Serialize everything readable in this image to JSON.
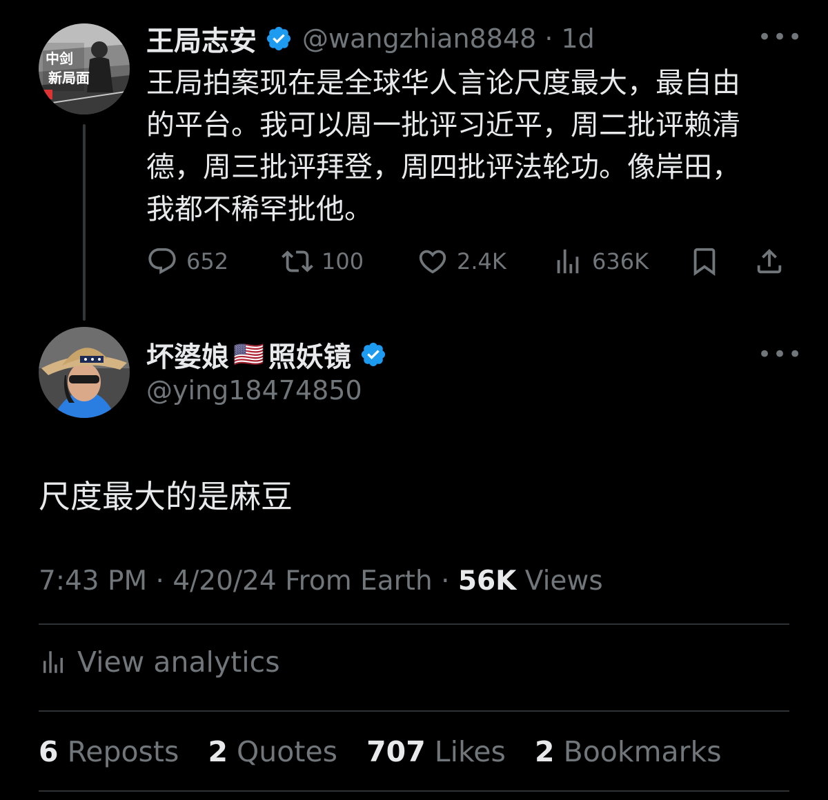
{
  "parent_tweet": {
    "author_name": "王局志安",
    "handle_time": "@wangzhian8848 · 1d",
    "text": "王局拍案现在是全球华人言论尺度最大，最自由的平台。我可以周一批评习近平，周二批评赖清德，周三批评拜登，周四批评法轮功。像岸田，我都不稀罕批他。",
    "avatar_text": "中剑新局面",
    "actions": {
      "replies": "652",
      "reposts": "100",
      "likes": "2.4K",
      "views": "636K"
    },
    "more_icon": "more-horizontal-icon"
  },
  "reply_tweet": {
    "author_name_part1": "坏婆娘",
    "flag": "🇺🇸",
    "author_name_part2": "照妖镜",
    "handle": "@ying18474850",
    "text": "尺度最大的是麻豆",
    "more_icon": "more-horizontal-icon"
  },
  "meta": {
    "time": "7:43 PM · 4/20/24 From Earth · ",
    "views_count": "56K",
    "views_label": " Views"
  },
  "analytics": {
    "label": "View analytics"
  },
  "stats": {
    "reposts_count": "6",
    "reposts_label": "Reposts",
    "quotes_count": "2",
    "quotes_label": "Quotes",
    "likes_count": "707",
    "likes_label": "Likes",
    "bookmarks_count": "2",
    "bookmarks_label": "Bookmarks"
  },
  "colors": {
    "background": "#000000",
    "text": "#e7e9ea",
    "secondary": "#71767b",
    "verified": "#1d9bf0",
    "divider": "#2f3336"
  }
}
